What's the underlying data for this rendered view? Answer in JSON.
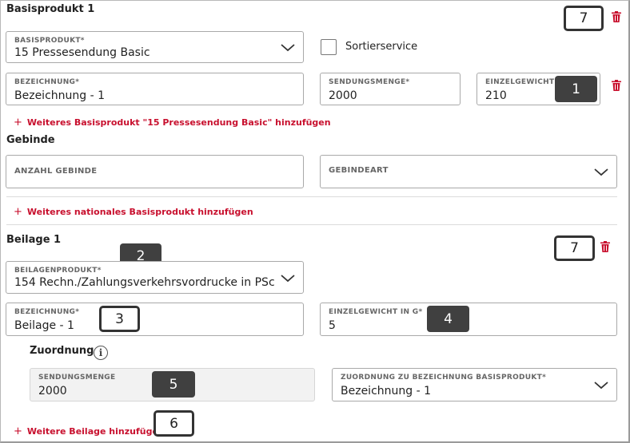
{
  "basisprodukt": {
    "heading": "Basisprodukt 1",
    "product_label": "BASISPRODUKT*",
    "product_value": "15 Pressesendung Basic",
    "sortierservice_label": "Sortierservice",
    "bezeichnung_label": "BEZEICHNUNG*",
    "bezeichnung_value": "Bezeichnung - 1",
    "sendungsmenge_label": "SENDUNGSMENGE*",
    "sendungsmenge_value": "2000",
    "einzelgewicht_label": "EINZELGEWICHT I",
    "einzelgewicht_value": "210",
    "add_link": "Weiteres Basisprodukt \"15 Pressesendung Basic\" hinzufügen"
  },
  "gebinde": {
    "heading": "Gebinde",
    "anzahl_label": "ANZAHL GEBINDE",
    "art_label": "GEBINDEART"
  },
  "add_national_link": "Weiteres nationales Basisprodukt hinzufügen",
  "beilage": {
    "heading": "Beilage 1",
    "product_label": "BEILAGENPRODUKT*",
    "product_value": "154 Rechn./Zahlungsverkehrsvordrucke in PSc",
    "bezeichnung_label": "BEZEICHNUNG*",
    "bezeichnung_value": "Beilage - 1",
    "einzelgewicht_label": "EINZELGEWICHT IN G*",
    "einzelgewicht_value": "5",
    "zuordnung_heading": "Zuordnung",
    "sendungsmenge_label": "SENDUNGSMENGE",
    "sendungsmenge_value": "2000",
    "zuordnung_label": "ZUORDNUNG ZU BEZEICHNUNG BASISPRODUKT*",
    "zuordnung_value": "Bezeichnung - 1",
    "add_link": "Weitere Beilage hinzufügen"
  },
  "add_plus": "+",
  "info_glyph": "i",
  "badges": [
    "7",
    "1",
    "2",
    "3",
    "4",
    "7",
    "5",
    "6"
  ],
  "colors": {
    "accent": "#c8102e",
    "badge": "#404040"
  }
}
